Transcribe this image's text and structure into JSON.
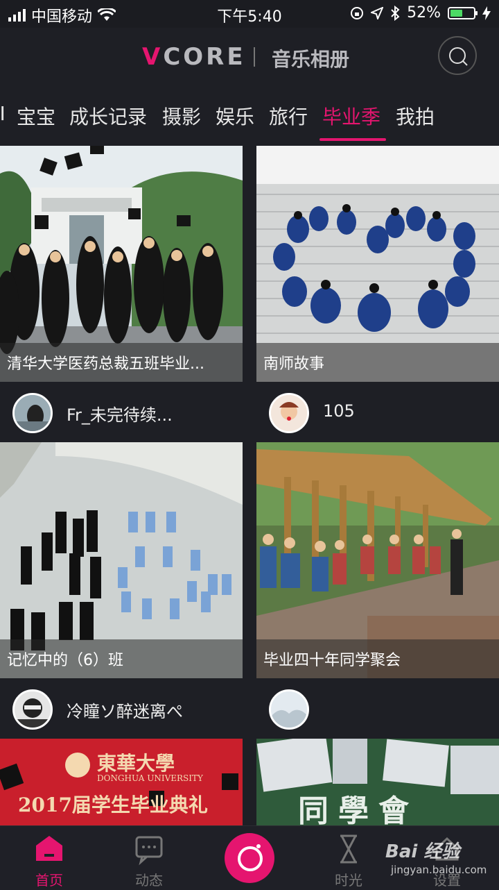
{
  "status_bar": {
    "carrier": "中国移动",
    "time": "下午5:40",
    "battery_percent": "52%",
    "battery_level": 0.52,
    "icons": [
      "signal-icon",
      "wifi-icon",
      "orientation-lock-icon",
      "location-icon",
      "bluetooth-icon",
      "battery-icon"
    ]
  },
  "header": {
    "brand": "VCORE",
    "subtitle": "音乐相册",
    "search_icon": "search-icon"
  },
  "tabs": {
    "items": [
      "Ⅱ",
      "宝宝",
      "成长记录",
      "摄影",
      "娱乐",
      "旅行",
      "毕业季",
      "我拍"
    ],
    "active": "毕业季"
  },
  "cards": [
    {
      "title": "清华大学医药总裁五班毕业...",
      "user": "Fr_未完待续..."
    },
    {
      "title": "南师故事",
      "user": "105"
    },
    {
      "title": "记忆中的（6）班",
      "user": "冷瞳ソ醉迷离ぺ"
    },
    {
      "title": "毕业四十年同学聚会",
      "user": ""
    },
    {
      "photo_text": "東華大學",
      "photo_text2": "DONGHUA UNIVERSITY",
      "photo_text3": "2017届学生毕业典礼"
    },
    {
      "photo_text": "同學會"
    }
  ],
  "tabbar": {
    "home": "首页",
    "feed": "动态",
    "time": "时光",
    "settings": "设置"
  },
  "watermark": {
    "main": "Bai 经验",
    "url": "jingyan.baidu.com"
  },
  "colors": {
    "accent": "#e5156f",
    "background": "#1e1f25"
  }
}
